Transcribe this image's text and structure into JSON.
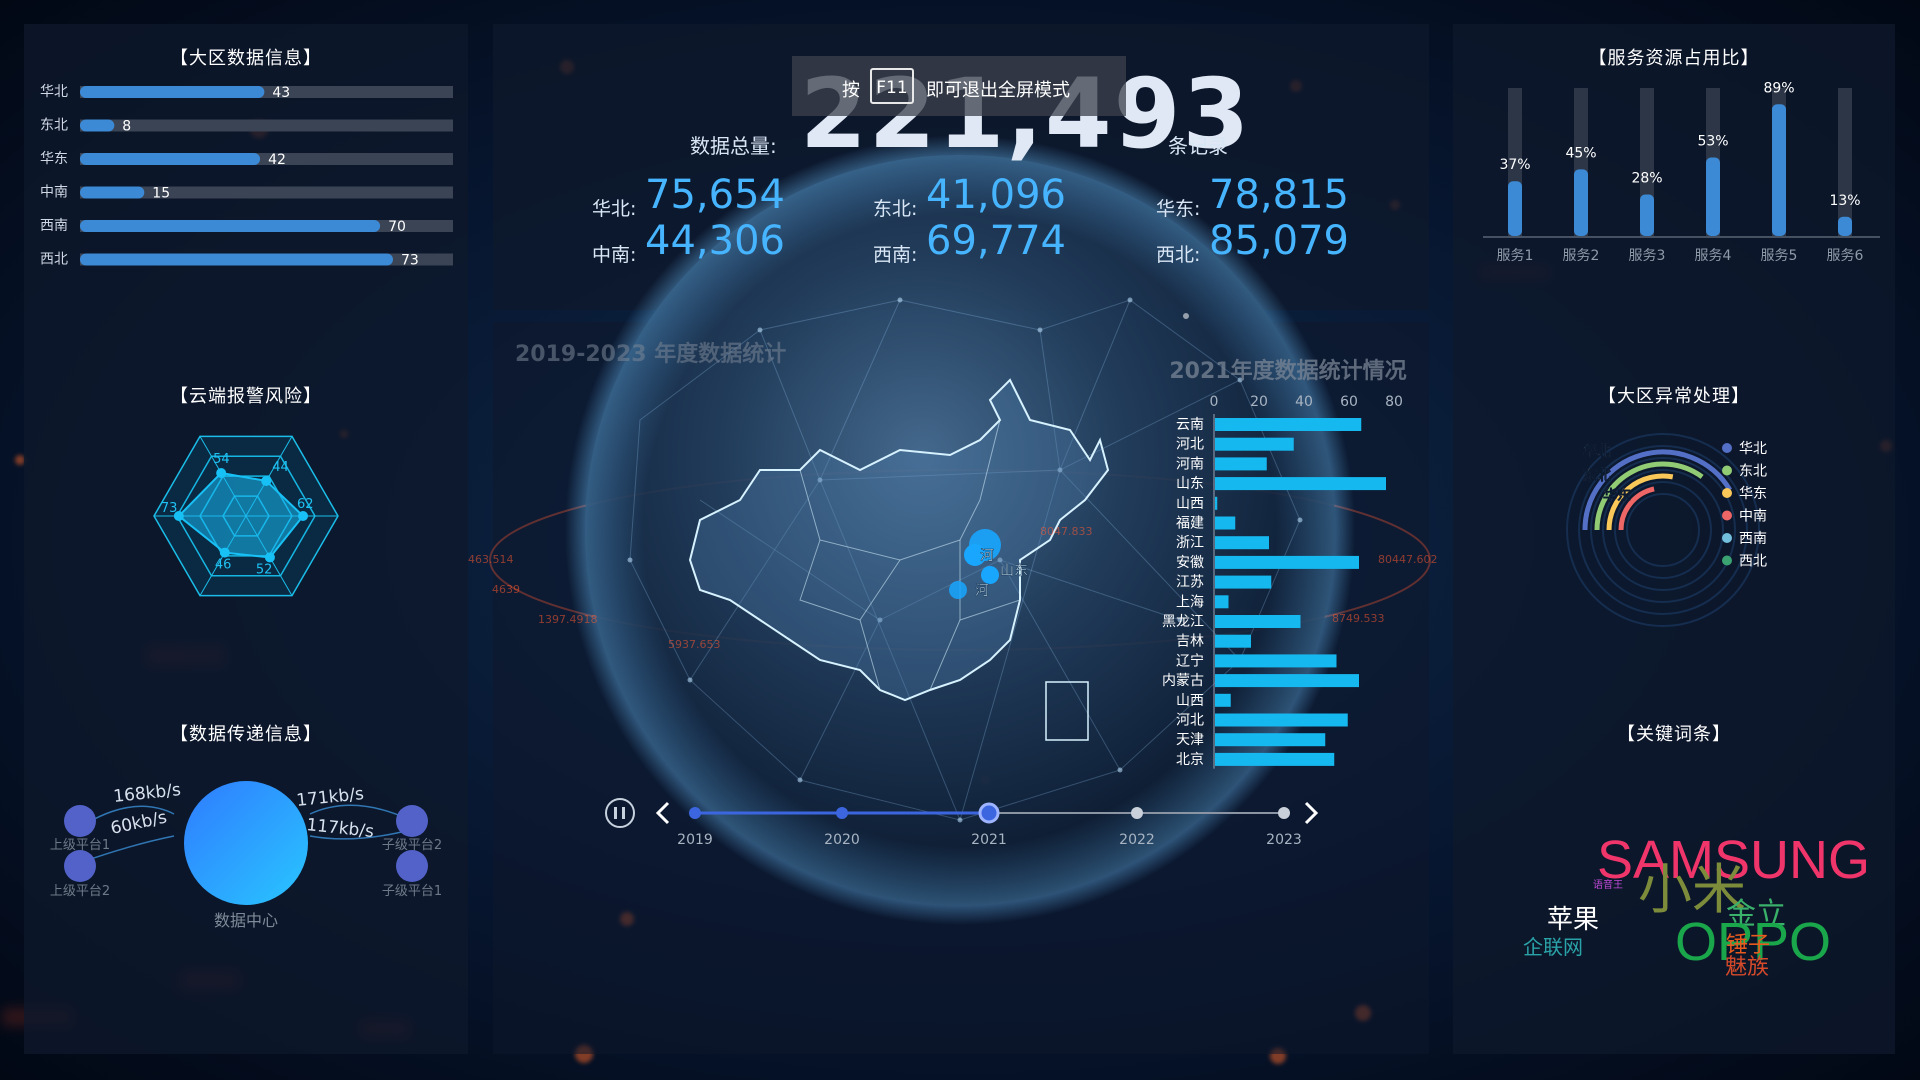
{
  "colors": {
    "bar": "#3c8ad6",
    "accent": "#46b4ff",
    "cyan": "#16b8f0",
    "track": "#3a4454"
  },
  "toast": {
    "prefix": "按",
    "key": "F11",
    "suffix": "即可退出全屏模式"
  },
  "totals": {
    "label": "数据总量:",
    "value": "221,493",
    "unit": "条记录",
    "regions": [
      {
        "label": "华北:",
        "value": "75,654"
      },
      {
        "label": "东北:",
        "value": "41,096"
      },
      {
        "label": "华东:",
        "value": "78,815"
      },
      {
        "label": "中南:",
        "value": "44,306"
      },
      {
        "label": "西南:",
        "value": "69,774"
      },
      {
        "label": "西北:",
        "value": "85,079"
      }
    ]
  },
  "panels": {
    "region_data": {
      "title": "【大区数据信息】"
    },
    "alarm": {
      "title": "【云端报警风险】"
    },
    "transfer": {
      "title": "【数据传递信息】"
    },
    "service": {
      "title": "【服务资源占用比】"
    },
    "anomaly": {
      "title": "【大区异常处理】"
    },
    "keywords": {
      "title": "【关键词条】"
    }
  },
  "chart_data": [
    {
      "type": "bar",
      "title": "【大区数据信息】",
      "orientation": "horizontal",
      "categories": [
        "华北",
        "东北",
        "华东",
        "中南",
        "西南",
        "西北"
      ],
      "values": [
        43,
        8,
        42,
        15,
        70,
        73
      ],
      "max": 87
    },
    {
      "type": "radar",
      "title": "【云端报警风险】",
      "values": [
        44,
        62,
        52,
        46,
        73,
        54
      ],
      "max": 100
    },
    {
      "type": "bar",
      "title": "【服务资源占用比】",
      "categories": [
        "服务1",
        "服务2",
        "服务3",
        "服务4",
        "服务5",
        "服务6"
      ],
      "values": [
        37,
        45,
        28,
        53,
        89,
        13
      ],
      "unit": "%",
      "ylim": [
        0,
        100
      ]
    },
    {
      "type": "bar",
      "title": "2021年度数据统计情况",
      "orientation": "horizontal",
      "categories": [
        "云南",
        "河北",
        "河南",
        "山东",
        "山西",
        "福建",
        "浙江",
        "安徽",
        "江苏",
        "上海",
        "黑龙江",
        "吉林",
        "辽宁",
        "内蒙古",
        "山西",
        "河北",
        "天津",
        "北京"
      ],
      "values": [
        65,
        35,
        23,
        76,
        1,
        9,
        24,
        64,
        25,
        6,
        38,
        16,
        54,
        64,
        7,
        59,
        49,
        53
      ],
      "xticks": [
        0,
        20,
        40,
        60,
        80
      ],
      "xlim": [
        0,
        80
      ]
    },
    {
      "type": "radial-bar",
      "title": "【大区异常处理】",
      "categories": [
        "华北",
        "东北",
        "华东",
        "中南",
        "西南",
        "西北"
      ],
      "colors": [
        "#5470c6",
        "#91cc75",
        "#fac858",
        "#ee6666",
        "#73c0de",
        "#3ba272"
      ],
      "values": [
        92,
        78,
        62,
        48,
        0,
        0
      ]
    }
  ],
  "center_chart": {
    "faded_title": "2019-2023 年度数据统计",
    "map_labels": [
      "河",
      "山东",
      "河"
    ]
  },
  "transfer": {
    "center_label": "数据中心",
    "nodes": [
      {
        "label": "上级平台1"
      },
      {
        "label": "上级平台2"
      },
      {
        "label": "子级平台2"
      },
      {
        "label": "子级平台1"
      }
    ],
    "speeds": [
      "168kb/s",
      "60kb/s",
      "171kb/s",
      "117kb/s"
    ]
  },
  "timeline": {
    "years": [
      "2019",
      "2020",
      "2021",
      "2022",
      "2023"
    ],
    "current_index": 2,
    "playing": true
  },
  "keywords": [
    {
      "text": "SAMSUNG",
      "color": "#f0356b"
    },
    {
      "text": "小米",
      "color": "#7d8c3a"
    },
    {
      "text": "金立",
      "color": "#3ab16a"
    },
    {
      "text": "苹果",
      "color": "#ffffff"
    },
    {
      "text": "OPPO",
      "color": "#1aa64a"
    },
    {
      "text": "锤子",
      "color": "#e85a1e"
    },
    {
      "text": "企联网",
      "color": "#2aa3a8"
    },
    {
      "text": "魅族",
      "color": "#d64a2a"
    },
    {
      "text": "语音王",
      "color": "#c04ad6"
    }
  ],
  "globe_labels": [
    "463.514",
    "4639",
    "1397.4918",
    "5937.653",
    "8047.833",
    "8749.533",
    "80447.602"
  ]
}
